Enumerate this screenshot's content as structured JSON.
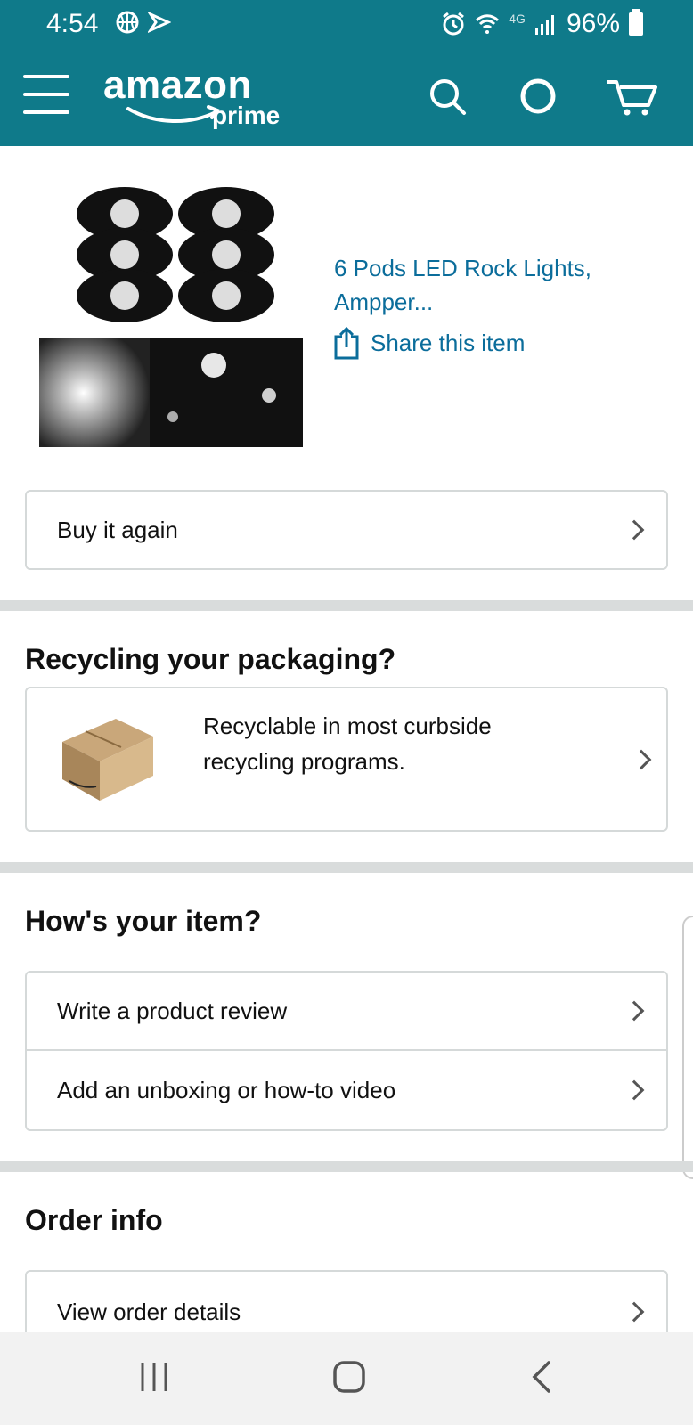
{
  "status": {
    "time": "4:54",
    "battery_percent": "96%",
    "network": "4G"
  },
  "header": {
    "logo_main": "amazon",
    "logo_sub": "prime",
    "brand_color": "#0f7a8a"
  },
  "product": {
    "title": "6 Pods LED Rock Lights, Ampper...",
    "share_label": "Share this item"
  },
  "buy_again": {
    "label": "Buy it again"
  },
  "recycling": {
    "title": "Recycling your packaging?",
    "text": "Recyclable in most curbside recycling programs."
  },
  "item_section": {
    "title": "How's your item?",
    "items": [
      {
        "label": "Write a product review"
      },
      {
        "label": "Add an unboxing or how-to video"
      }
    ]
  },
  "order_info": {
    "title": "Order info",
    "items": [
      {
        "label": "View order details"
      }
    ]
  },
  "icons": [
    "menu-icon",
    "search-icon",
    "alexa-icon",
    "cart-icon",
    "share-icon",
    "chevron-right-icon",
    "recent-apps-icon",
    "home-icon",
    "back-icon"
  ],
  "colors": {
    "link": "#0b6d9b",
    "divider": "#d9dcdc",
    "border": "#d5d9d9"
  }
}
